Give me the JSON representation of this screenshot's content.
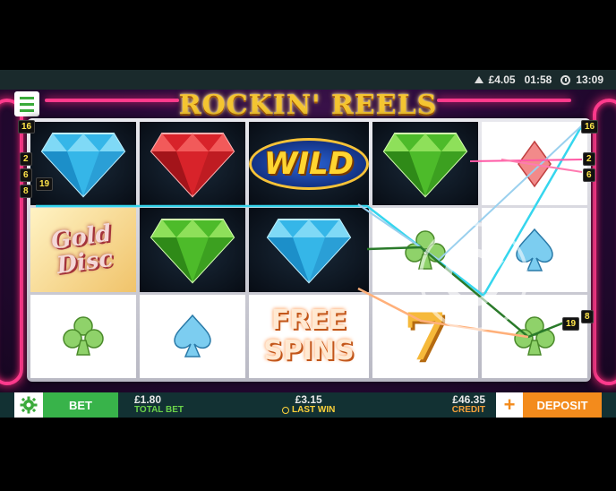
{
  "status": {
    "balance": "£4.05",
    "session_time": "01:58",
    "clock_time": "13:09"
  },
  "game": {
    "title": "ROCKIN' REELS",
    "reels": [
      [
        {
          "symbol": "blue-diamond"
        },
        {
          "symbol": "gold-disc",
          "text_line1": "Gold",
          "text_line2": "Disc"
        },
        {
          "symbol": "club"
        }
      ],
      [
        {
          "symbol": "red-diamond"
        },
        {
          "symbol": "green-diamond"
        },
        {
          "symbol": "spade"
        }
      ],
      [
        {
          "symbol": "wild",
          "text": "WILD"
        },
        {
          "symbol": "blue-diamond"
        },
        {
          "symbol": "free-spins",
          "text_line1": "FREE",
          "text_line2": "SPINS"
        }
      ],
      [
        {
          "symbol": "green-diamond"
        },
        {
          "symbol": "club"
        },
        {
          "symbol": "seven",
          "text": "7"
        }
      ],
      [
        {
          "symbol": "diamond-suit"
        },
        {
          "symbol": "spade"
        },
        {
          "symbol": "club"
        }
      ]
    ],
    "line_markers_left": [
      "16",
      "2",
      "6",
      "8",
      "19"
    ],
    "line_markers_right": [
      "16",
      "2",
      "6",
      "19",
      "8"
    ],
    "colors": {
      "accent_green": "#38b34a",
      "deposit_orange": "#f38b1c",
      "neon_pink": "#ff3a8c",
      "logo_gold": "#f4c531"
    }
  },
  "bottom_bar": {
    "bet_label": "BET",
    "total_bet_value": "£1.80",
    "total_bet_label": "TOTAL BET",
    "last_win_value": "£3.15",
    "last_win_label": "LAST WIN",
    "credit_value": "£46.35",
    "credit_label": "CREDIT",
    "plus_label": "+",
    "deposit_label": "DEPOSIT"
  }
}
